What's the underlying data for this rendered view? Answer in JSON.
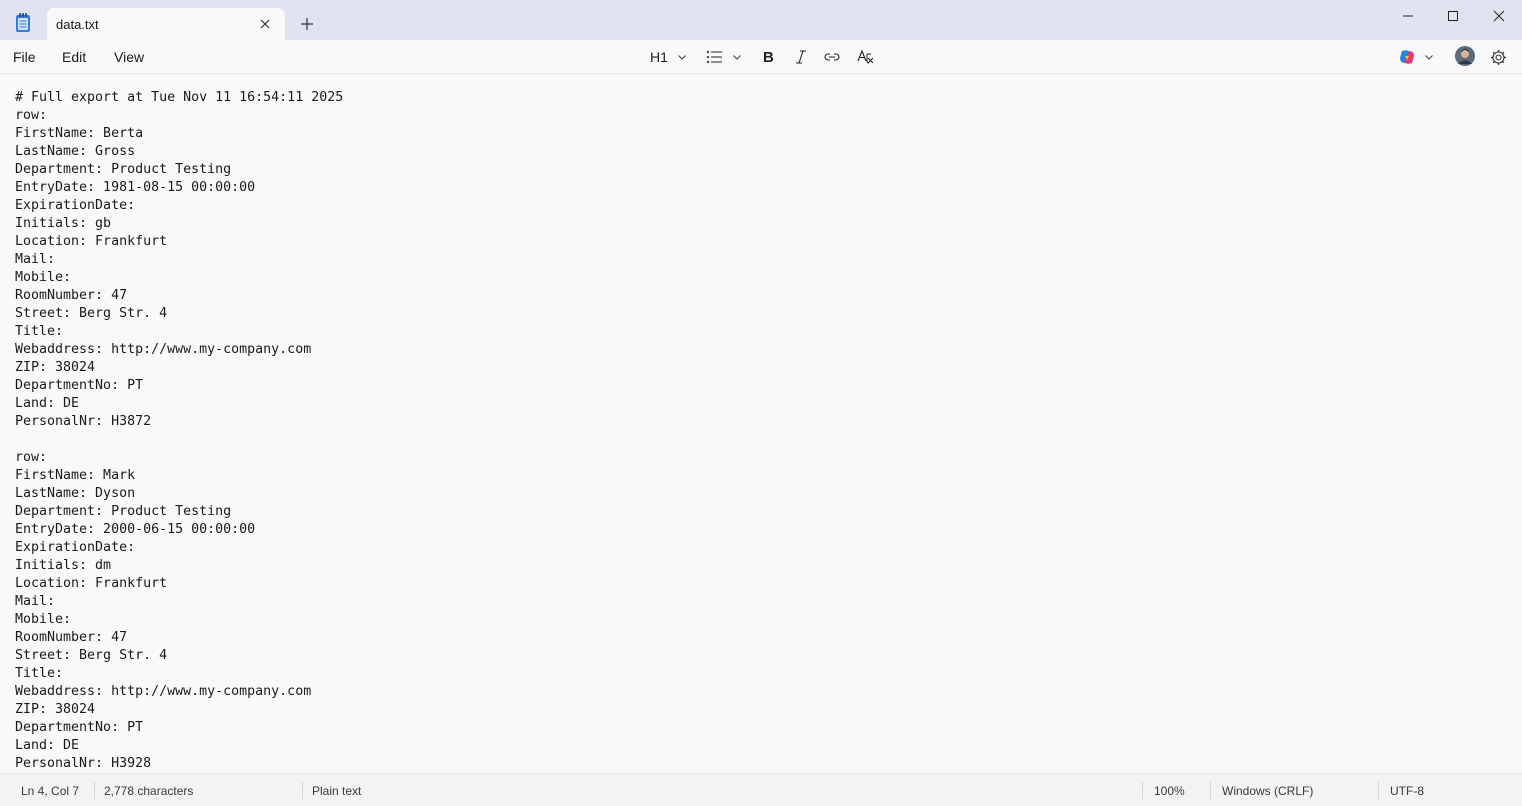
{
  "tab": {
    "title": "data.txt"
  },
  "menu": {
    "file": "File",
    "edit": "Edit",
    "view": "View"
  },
  "toolbar": {
    "heading": "H1"
  },
  "editor": {
    "lines": [
      "# Full export at Tue Nov 11 16:54:11 2025",
      "row:",
      "FirstName: Berta",
      "LastName: Gross",
      "Department: Product Testing",
      "EntryDate: 1981-08-15 00:00:00",
      "ExpirationDate:",
      "Initials: gb",
      "Location: Frankfurt",
      "Mail:",
      "Mobile:",
      "RoomNumber: 47",
      "Street: Berg Str. 4",
      "Title:",
      "Webaddress: http://www.my-company.com",
      "ZIP: 38024",
      "DepartmentNo: PT",
      "Land: DE",
      "PersonalNr: H3872",
      "",
      "row:",
      "FirstName: Mark",
      "LastName: Dyson",
      "Department: Product Testing",
      "EntryDate: 2000-06-15 00:00:00",
      "ExpirationDate:",
      "Initials: dm",
      "Location: Frankfurt",
      "Mail:",
      "Mobile:",
      "RoomNumber: 47",
      "Street: Berg Str. 4",
      "Title:",
      "Webaddress: http://www.my-company.com",
      "ZIP: 38024",
      "DepartmentNo: PT",
      "Land: DE",
      "PersonalNr: H3928"
    ]
  },
  "status": {
    "position": "Ln 4, Col 7",
    "characters": "2,778 characters",
    "format": "Plain text",
    "zoom": "100%",
    "line_ending": "Windows (CRLF)",
    "encoding": "UTF-8"
  },
  "icons": {
    "app": "notepad-icon",
    "close_tab": "close-icon",
    "new_tab": "plus-icon",
    "heading_dropdown": "chevron-down-icon",
    "list": "list-icon",
    "bold": "bold-icon",
    "italic": "italic-icon",
    "link": "link-icon",
    "clear_format": "clear-formatting-icon",
    "copilot": "copilot-icon",
    "avatar": "avatar",
    "settings": "gear-icon",
    "minimize": "minimize-icon",
    "maximize": "maximize-icon",
    "close_window": "close-icon"
  },
  "colors": {
    "titlebar": "#dfe3f0",
    "surface": "#f9f9f9",
    "accent": "#2f6ed6"
  }
}
